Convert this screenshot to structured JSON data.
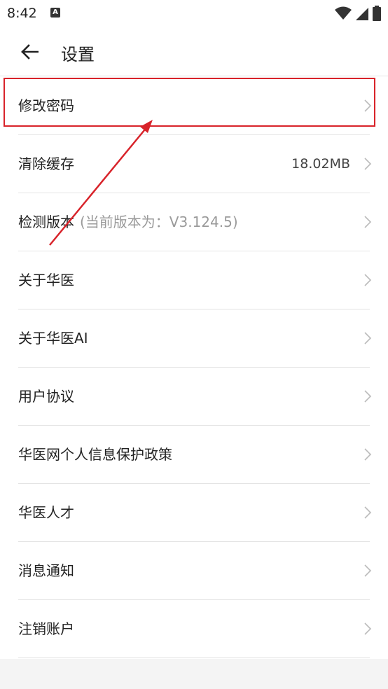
{
  "status_bar": {
    "time": "8:42",
    "notification_icon": "A"
  },
  "header": {
    "title": "设置"
  },
  "settings_items": [
    {
      "label": "修改密码",
      "sub": "",
      "value": ""
    },
    {
      "label": "清除缓存",
      "sub": "",
      "value": "18.02MB"
    },
    {
      "label": "检测版本",
      "sub": "(当前版本为：V3.124.5)",
      "value": ""
    },
    {
      "label": "关于华医",
      "sub": "",
      "value": ""
    },
    {
      "label": "关于华医AI",
      "sub": "",
      "value": ""
    },
    {
      "label": "用户协议",
      "sub": "",
      "value": ""
    },
    {
      "label": "华医网个人信息保护政策",
      "sub": "",
      "value": ""
    },
    {
      "label": "华医人才",
      "sub": "",
      "value": ""
    },
    {
      "label": "消息通知",
      "sub": "",
      "value": ""
    },
    {
      "label": "注销账户",
      "sub": "",
      "value": ""
    }
  ],
  "colors": {
    "annotation_red": "#d8232a",
    "divider": "#e4e4e4",
    "secondary_text": "#9a9a9a"
  },
  "icons": {
    "back": "arrow-left-icon",
    "row_chevron": "chevron-right-icon",
    "wifi": "wifi-icon",
    "signal": "cell-signal-icon",
    "battery": "battery-icon"
  }
}
